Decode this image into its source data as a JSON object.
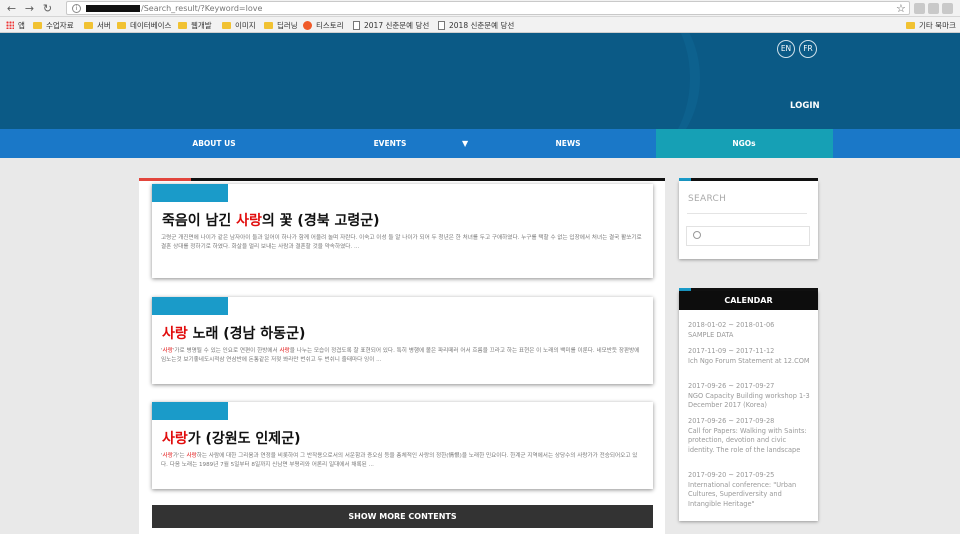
{
  "browser": {
    "url_suffix": "/Search_result/?Keyword=love",
    "bookmarks": [
      {
        "label": "앱",
        "icon": "apps-grid-icon"
      },
      {
        "label": "수업자료",
        "icon": "folder-icon"
      },
      {
        "label": "서버",
        "icon": "folder-icon"
      },
      {
        "label": "데이터베이스",
        "icon": "folder-icon"
      },
      {
        "label": "웹개발",
        "icon": "folder-icon"
      },
      {
        "label": "이미지",
        "icon": "folder-icon"
      },
      {
        "label": "딥러닝",
        "icon": "folder-icon"
      },
      {
        "label": "티스토리",
        "icon": "tistory-icon"
      },
      {
        "label": "2017 신춘문예 당선",
        "icon": "document-icon"
      },
      {
        "label": "2018 신춘문예 당선",
        "icon": "document-icon"
      }
    ],
    "other_bookmarks": "기타 북마크"
  },
  "header": {
    "lang_en": "EN",
    "lang_fr": "FR",
    "login": "LOGIN",
    "colors": {
      "header": "#0b5a86",
      "nav": "#1a78c8",
      "active": "#16a0b5"
    }
  },
  "nav": {
    "items": [
      "ABOUT US",
      "EVENTS",
      "NEWS",
      "NGOs"
    ],
    "dropdown_arrow": "▼",
    "active": "NGOs"
  },
  "results": [
    {
      "title_pre": "죽음이 남긴 ",
      "title_hl": "사랑",
      "title_post": "의 꽃 (경북 고령군)",
      "text": "고령군 개진면에 나이가 같은 남자아이 둘과 일어이 하나가 함께 어울려 놀며 자란다. 이숙고 이성 둘 알 나이가 되어 두 청년은 한 처녀를 두고 구애하였다. 누구를 택할 수 없는 입장에서 처녀는 결국 활쏘기로 결혼 상대를 정하기로 하였다. 화살을 멀리 보내는 사람과 결혼할 것을 약속하였다. ..."
    },
    {
      "title_pre": "",
      "title_hl": "사랑",
      "title_post": " 노래 (경남 하동군)",
      "text_pre": "'",
      "text_hl": "사랑",
      "text_mid": "'가로 병명될 수 있는 인요로 연편이 한방에서 ",
      "text_hl2": "사랑",
      "text_post": "을 나누는 모습이 정겹도록 잘 표현되어 있다. 특히 병행에 볼은 파리떼러 어서 흐름을 끄라고 하는 표현은 이 노래의 백미를 이룬다. 네모반듯 장판방에 임노는것 보기좋네도시적삼 연삼반에 돈통같은 저젖 봐라만 번쉬고 두 번쉬니 줄태마다 잉이 ..."
    },
    {
      "title_pre": "",
      "title_hl": "사랑",
      "title_post": "가 (강원도 인제군)",
      "text_pre": "'",
      "text_hl": "사랑",
      "text_mid": "가'는 ",
      "text_hl2": "사랑",
      "text_post": "하는 사람에 대한 그리움과 연정을 비롯하여 그 반작용으로서의 서운함과 증오심 등을 총체적인 사랑의 정한(情恨)을 노래한 민요이다. 한계군 지역에서는 상당수의 사랑가가 전승되어오고 있다. 다음 노래는 1989년 7월 5일부터 8일까지 신남면 부평리와 어론리 일대에서 채록된 ..."
    }
  ],
  "show_more": "SHOW MORE CONTENTS",
  "sidebar": {
    "search_title": "SEARCH",
    "calendar_title": "CALENDAR",
    "events": [
      {
        "date": "2018-01-02 ~ 2018-01-06",
        "title": "SAMPLE DATA"
      },
      {
        "date": "2017-11-09 ~ 2017-11-12",
        "title": "Ich Ngo Forum Statement at 12.COM"
      },
      {
        "date": "2017-09-26 ~ 2017-09-27",
        "title": "NGO Capacity Building workshop 1-3 December 2017 (Korea)"
      },
      {
        "date": "2017-09-26 ~ 2017-09-28",
        "title": "Call for Papers: Walking with Saints: protection, devotion and civic identity. The role of the landscape"
      },
      {
        "date": "2017-09-20 ~ 2017-09-25",
        "title": "International conference: \"Urban Cultures, Superdiversity and Intangible Heritage\""
      }
    ]
  }
}
